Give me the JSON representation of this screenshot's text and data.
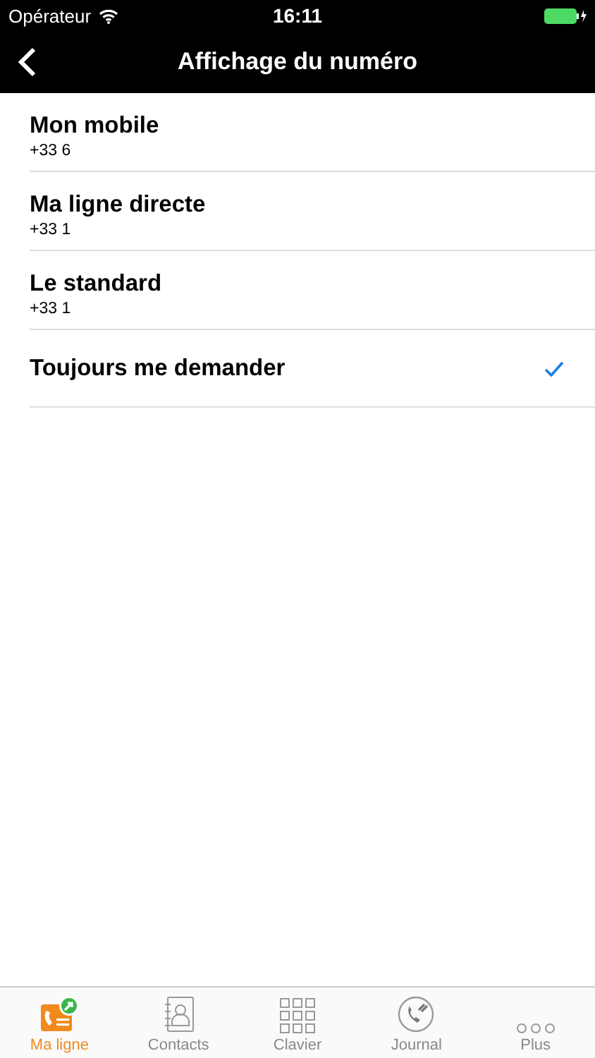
{
  "status_bar": {
    "carrier": "Opérateur",
    "time": "16:11"
  },
  "nav": {
    "title": "Affichage du numéro"
  },
  "options": [
    {
      "label": "Mon mobile",
      "number": "+33 6",
      "selected": false
    },
    {
      "label": "Ma ligne directe",
      "number": "+33 1",
      "selected": false
    },
    {
      "label": "Le standard",
      "number": "+33 1",
      "selected": false
    },
    {
      "label": "Toujours me demander",
      "selected": true
    }
  ],
  "tabs": [
    {
      "label": "Ma ligne",
      "kind": "line",
      "selected": true
    },
    {
      "label": "Contacts",
      "kind": "contacts",
      "selected": false
    },
    {
      "label": "Clavier",
      "kind": "keypad",
      "selected": false
    },
    {
      "label": "Journal",
      "kind": "journal",
      "selected": false
    },
    {
      "label": "Plus",
      "kind": "more",
      "selected": false
    }
  ]
}
